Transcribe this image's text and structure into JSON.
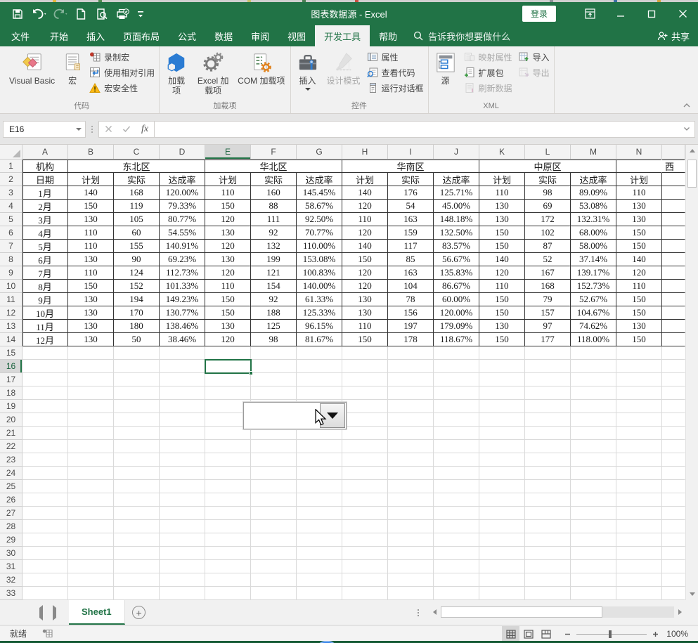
{
  "window": {
    "title": "图表数据源 - Excel",
    "login_label": "登录"
  },
  "tabs": [
    "文件",
    "开始",
    "插入",
    "页面布局",
    "公式",
    "数据",
    "审阅",
    "视图",
    "开发工具",
    "帮助"
  ],
  "search_text": "告诉我你想要做什么",
  "share_label": "共享",
  "ribbon": {
    "code": {
      "label": "代码",
      "vb": "Visual Basic",
      "macros": "宏",
      "record": "录制宏",
      "relative": "使用相对引用",
      "security": "宏安全性"
    },
    "addins": {
      "label": "加载项",
      "addins": "加载项",
      "excel_addins": "Excel 加载项",
      "com_addins": "COM 加载项"
    },
    "controls": {
      "label": "控件",
      "insert": "插入",
      "design_mode": "设计模式",
      "properties": "属性",
      "view_code": "查看代码",
      "run_dialog": "运行对话框"
    },
    "xml": {
      "label": "XML",
      "source": "源",
      "map_props": "映射属性",
      "expansion": "扩展包",
      "refresh": "刷新数据",
      "import": "导入",
      "export": "导出"
    }
  },
  "formula_bar": {
    "name_box": "E16",
    "fx_label": "fx",
    "formula_value": ""
  },
  "sheet": {
    "columns": [
      "A",
      "B",
      "C",
      "D",
      "E",
      "F",
      "G",
      "H",
      "I",
      "J",
      "K",
      "L",
      "M",
      "N"
    ],
    "active_col": "E",
    "active_row": 16,
    "total_rows": 33,
    "corner_label": "机构",
    "date_label": "日期",
    "regions": [
      "东北区",
      "华北区",
      "华南区",
      "中原区"
    ],
    "partial_region": "西",
    "sub_headers": [
      "计划",
      "实际",
      "达成率"
    ],
    "months": [
      "1月",
      "2月",
      "3月",
      "4月",
      "5月",
      "6月",
      "7月",
      "8月",
      "9月",
      "10月",
      "11月",
      "12月"
    ],
    "data": [
      [
        "140",
        "168",
        "120.00%",
        "110",
        "160",
        "145.45%",
        "140",
        "176",
        "125.71%",
        "110",
        "98",
        "89.09%",
        "110"
      ],
      [
        "150",
        "119",
        "79.33%",
        "150",
        "88",
        "58.67%",
        "120",
        "54",
        "45.00%",
        "130",
        "69",
        "53.08%",
        "130"
      ],
      [
        "130",
        "105",
        "80.77%",
        "120",
        "111",
        "92.50%",
        "110",
        "163",
        "148.18%",
        "130",
        "172",
        "132.31%",
        "130"
      ],
      [
        "110",
        "60",
        "54.55%",
        "130",
        "92",
        "70.77%",
        "120",
        "159",
        "132.50%",
        "150",
        "102",
        "68.00%",
        "150"
      ],
      [
        "110",
        "155",
        "140.91%",
        "120",
        "132",
        "110.00%",
        "140",
        "117",
        "83.57%",
        "150",
        "87",
        "58.00%",
        "150"
      ],
      [
        "130",
        "90",
        "69.23%",
        "130",
        "199",
        "153.08%",
        "150",
        "85",
        "56.67%",
        "140",
        "52",
        "37.14%",
        "140"
      ],
      [
        "110",
        "124",
        "112.73%",
        "120",
        "121",
        "100.83%",
        "120",
        "163",
        "135.83%",
        "120",
        "167",
        "139.17%",
        "120"
      ],
      [
        "150",
        "152",
        "101.33%",
        "110",
        "154",
        "140.00%",
        "120",
        "104",
        "86.67%",
        "110",
        "168",
        "152.73%",
        "110"
      ],
      [
        "130",
        "194",
        "149.23%",
        "150",
        "92",
        "61.33%",
        "130",
        "78",
        "60.00%",
        "150",
        "79",
        "52.67%",
        "150"
      ],
      [
        "130",
        "170",
        "130.77%",
        "150",
        "188",
        "125.33%",
        "130",
        "156",
        "120.00%",
        "150",
        "157",
        "104.67%",
        "150"
      ],
      [
        "130",
        "180",
        "138.46%",
        "130",
        "125",
        "96.15%",
        "110",
        "197",
        "179.09%",
        "130",
        "97",
        "74.62%",
        "130"
      ],
      [
        "130",
        "50",
        "38.46%",
        "120",
        "98",
        "81.67%",
        "150",
        "178",
        "118.67%",
        "150",
        "177",
        "118.00%",
        "150"
      ]
    ]
  },
  "sheet_tabs": {
    "active": "Sheet1"
  },
  "status_bar": {
    "ready": "就绪",
    "zoom_level": "100%"
  },
  "colors": {
    "accent": "#217346",
    "titlebar": "#217346",
    "table_border": "#333333",
    "selection": "#217346"
  }
}
